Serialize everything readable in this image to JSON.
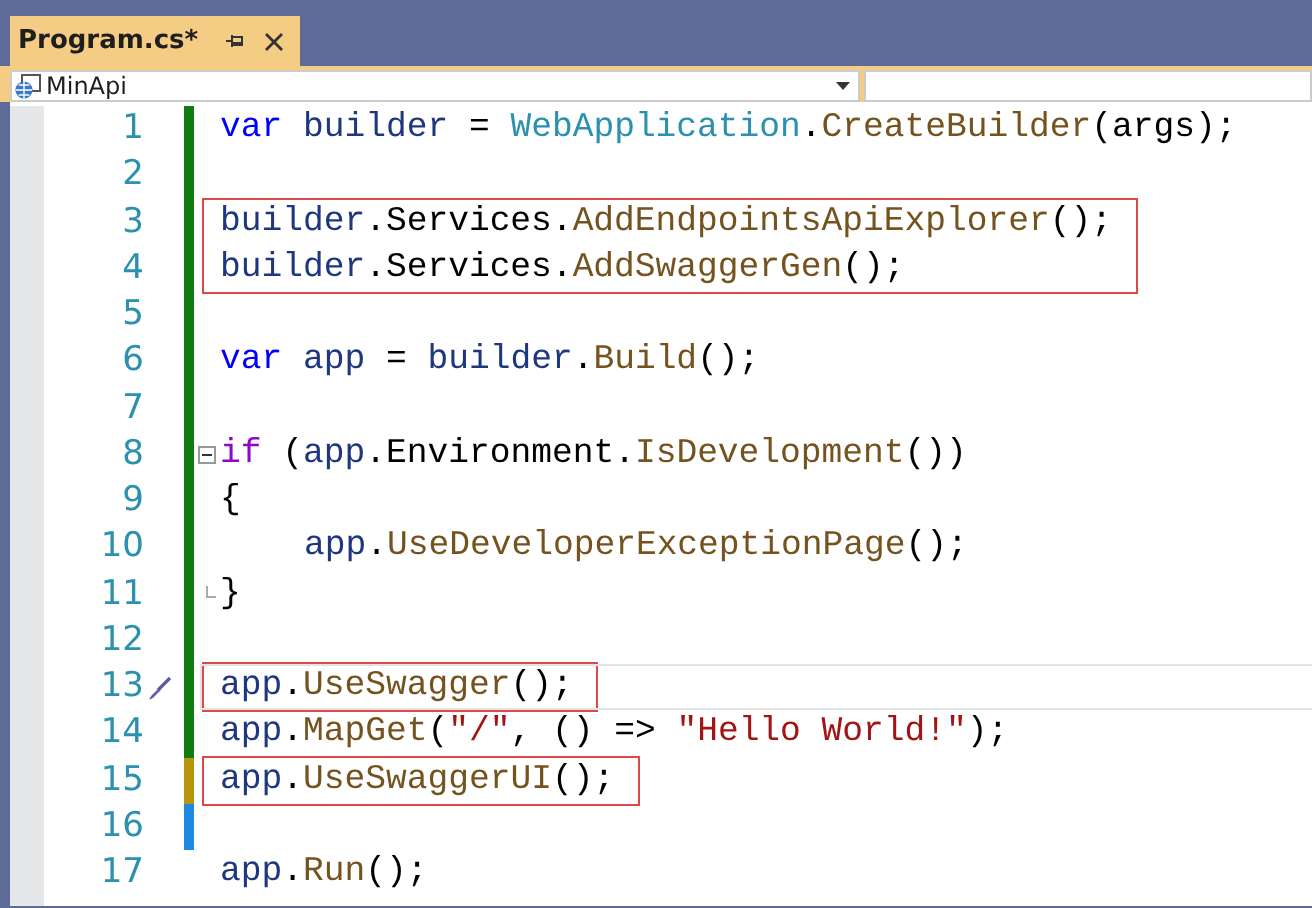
{
  "tab": {
    "title": "Program.cs*",
    "selected": true
  },
  "nav_bar": {
    "project": "MinApi"
  },
  "lines": [
    {
      "number": "1",
      "color": "#107c10",
      "tokens": [
        {
          "kind": "kw",
          "text": "var"
        },
        {
          "kind": "local",
          "text": " builder "
        },
        {
          "kind": "plain",
          "text": "= "
        },
        {
          "kind": "type",
          "text": "WebApplication"
        },
        {
          "kind": "plain",
          "text": "."
        },
        {
          "kind": "method",
          "text": "CreateBuilder"
        },
        {
          "kind": "plain",
          "text": "(args);"
        }
      ]
    },
    {
      "number": "2",
      "color": "#107c10"
    },
    {
      "number": "3",
      "color": "#107c10",
      "box": true,
      "tokens": [
        {
          "kind": "local",
          "text": "builder"
        },
        {
          "kind": "plain",
          "text": ".Services."
        },
        {
          "kind": "method",
          "text": "AddEndpointsApiExplorer"
        },
        {
          "kind": "plain",
          "text": "();"
        }
      ]
    },
    {
      "number": "4",
      "color": "#107c10",
      "box": true,
      "tokens": [
        {
          "kind": "local",
          "text": "builder"
        },
        {
          "kind": "plain",
          "text": ".Services."
        },
        {
          "kind": "method",
          "text": "AddSwaggerGen"
        },
        {
          "kind": "plain",
          "text": "();"
        }
      ]
    },
    {
      "number": "5",
      "color": "#107c10"
    },
    {
      "number": "6",
      "color": "#107c10",
      "tokens": [
        {
          "kind": "kw",
          "text": "var"
        },
        {
          "kind": "local",
          "text": " app "
        },
        {
          "kind": "plain",
          "text": "= "
        },
        {
          "kind": "local",
          "text": "builder"
        },
        {
          "kind": "plain",
          "text": "."
        },
        {
          "kind": "method",
          "text": "Build"
        },
        {
          "kind": "plain",
          "text": "();"
        }
      ]
    },
    {
      "number": "7",
      "color": "#107c10"
    },
    {
      "number": "8",
      "color": "#107c10",
      "fold_start": true,
      "tokens": [
        {
          "kind": "control",
          "text": "if"
        },
        {
          "kind": "plain",
          "text": " ("
        },
        {
          "kind": "local",
          "text": "app"
        },
        {
          "kind": "plain",
          "text": ".Environment."
        },
        {
          "kind": "method",
          "text": "IsDevelopment"
        },
        {
          "kind": "plain",
          "text": "())"
        }
      ]
    },
    {
      "number": "9",
      "color": "#107c10",
      "tokens": [
        {
          "kind": "plain",
          "text": "{"
        }
      ]
    },
    {
      "number": "10",
      "color": "#107c10",
      "indent": true,
      "tokens": [
        {
          "kind": "local",
          "text": "app"
        },
        {
          "kind": "plain",
          "text": "."
        },
        {
          "kind": "method",
          "text": "UseDeveloperExceptionPage"
        },
        {
          "kind": "plain",
          "text": "();"
        }
      ]
    },
    {
      "number": "11",
      "color": "#107c10",
      "fold_end": true,
      "tokens": [
        {
          "kind": "plain",
          "text": "}"
        }
      ]
    },
    {
      "number": "12",
      "color": "#107c10"
    },
    {
      "number": "13",
      "color": "#107c10",
      "box": true,
      "current": true,
      "quick_action": true,
      "tokens": [
        {
          "kind": "local",
          "text": "app"
        },
        {
          "kind": "plain",
          "text": "."
        },
        {
          "kind": "method",
          "text": "UseSwagger"
        },
        {
          "kind": "plain",
          "text": "();"
        }
      ]
    },
    {
      "number": "14",
      "color": "#107c10",
      "tokens": [
        {
          "kind": "local",
          "text": "app"
        },
        {
          "kind": "plain",
          "text": "."
        },
        {
          "kind": "method",
          "text": "MapGet"
        },
        {
          "kind": "plain",
          "text": "("
        },
        {
          "kind": "string",
          "text": "\"/\""
        },
        {
          "kind": "plain",
          "text": ", () => "
        },
        {
          "kind": "string",
          "text": "\"Hello World!\""
        },
        {
          "kind": "plain",
          "text": ");"
        }
      ]
    },
    {
      "number": "15",
      "color": "#b8960c",
      "box": true,
      "tokens": [
        {
          "kind": "local",
          "text": "app"
        },
        {
          "kind": "plain",
          "text": "."
        },
        {
          "kind": "method",
          "text": "UseSwaggerUI"
        },
        {
          "kind": "plain",
          "text": "();"
        }
      ]
    },
    {
      "number": "16",
      "color": "#1e88e5"
    },
    {
      "number": "17",
      "tokens": [
        {
          "kind": "local",
          "text": "app"
        },
        {
          "kind": "plain",
          "text": "."
        },
        {
          "kind": "method",
          "text": "Run"
        },
        {
          "kind": "plain",
          "text": "();"
        }
      ]
    }
  ]
}
